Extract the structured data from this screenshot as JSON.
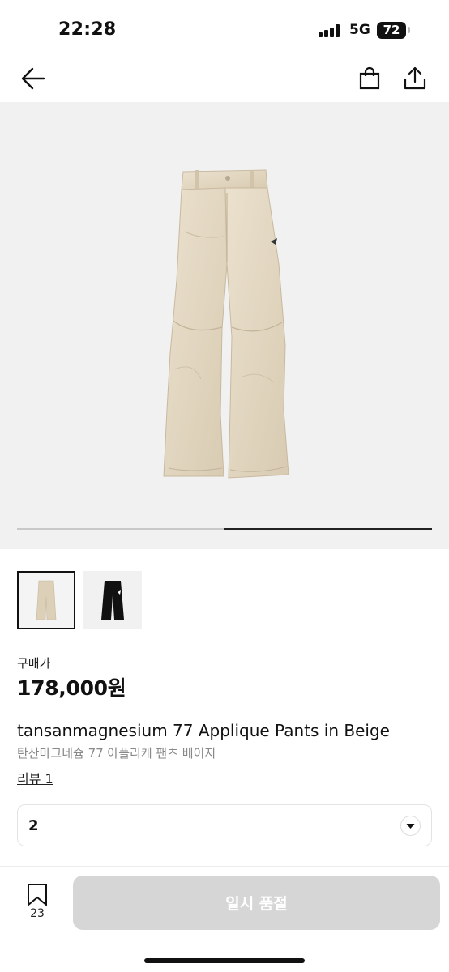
{
  "status_bar": {
    "time": "22:28",
    "network": "5G",
    "battery": "72"
  },
  "nav": {
    "back_icon": "arrow-left-icon",
    "cart_icon": "shopping-bag-icon",
    "share_icon": "share-icon"
  },
  "gallery": {
    "position": 2,
    "total": 2,
    "progress_fraction": 0.5,
    "thumbnails": [
      {
        "icon": "beige-pants-thumbnail",
        "selected": true
      },
      {
        "icon": "black-pants-thumbnail",
        "selected": false
      }
    ]
  },
  "product": {
    "price_label": "구매가",
    "price": "178,000원",
    "title_en": "tansanmagnesium 77 Applique Pants in Beige",
    "title_ko": "탄산마그네슘 77 아플리케 팬츠 베이지",
    "review_link": "리뷰 1"
  },
  "option_select": {
    "value": "2"
  },
  "bottom_bar": {
    "bookmark_count": "23",
    "cta_label": "일시 품절"
  },
  "colors": {
    "image_background": "#f1f1f1",
    "pants_beige": "#e3d7c2",
    "disabled_button": "#d6d6d6"
  }
}
